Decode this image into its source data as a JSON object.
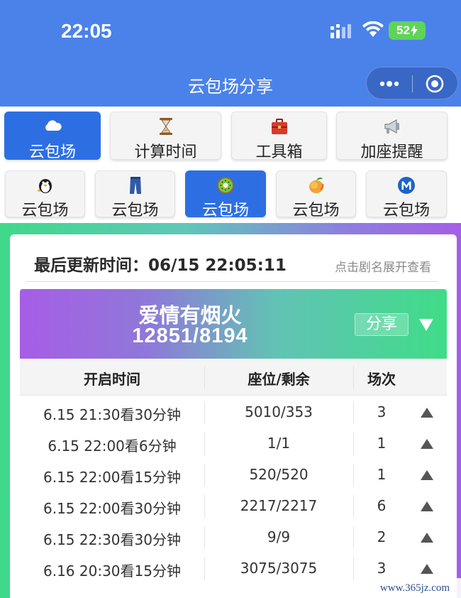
{
  "status_bar": {
    "time": "22:05",
    "battery": "52"
  },
  "header": {
    "title": "云包场分享"
  },
  "tabs_row1": [
    {
      "label": "云包场",
      "icon": "cloud-icon"
    },
    {
      "label": "计算时间",
      "icon": "hourglass-icon"
    },
    {
      "label": "工具箱",
      "icon": "toolbox-icon"
    },
    {
      "label": "加座提醒",
      "icon": "megaphone-icon"
    }
  ],
  "tabs_row2": [
    {
      "label": "云包场",
      "icon": "penguin-icon"
    },
    {
      "label": "云包场",
      "icon": "jeans-icon"
    },
    {
      "label": "云包场",
      "icon": "kiwi-icon"
    },
    {
      "label": "云包场",
      "icon": "mango-icon"
    },
    {
      "label": "云包场",
      "icon": "m-circle-icon"
    }
  ],
  "colors": {
    "primary": "#2d6fe3",
    "header_bg": "#4b82ea"
  },
  "card": {
    "update_label": "最后更新时间：06/15 22:05:11",
    "hint": "点击剧名展开查看"
  },
  "show": {
    "name": "爱情有烟火",
    "count": "12851/8194",
    "share_label": "分享"
  },
  "table": {
    "headers": [
      "开启时间",
      "座位/剩余",
      "场次"
    ],
    "rows": [
      {
        "time": "6.15 21:30看30分钟",
        "seats": "5010/353",
        "sessions": "3"
      },
      {
        "time": "6.15 22:00看6分钟",
        "seats": "1/1",
        "sessions": "1"
      },
      {
        "time": "6.15 22:00看15分钟",
        "seats": "520/520",
        "sessions": "1"
      },
      {
        "time": "6.15 22:00看30分钟",
        "seats": "2217/2217",
        "sessions": "6"
      },
      {
        "time": "6.15 22:30看30分钟",
        "seats": "9/9",
        "sessions": "2"
      },
      {
        "time": "6.16 20:30看15分钟",
        "seats": "3075/3075",
        "sessions": "3"
      }
    ]
  },
  "watermark": "www.365jz.com"
}
